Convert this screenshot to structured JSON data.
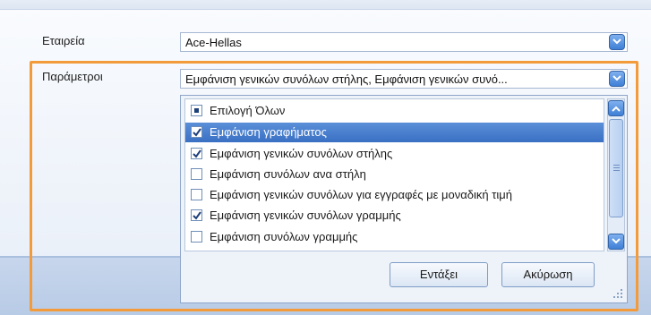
{
  "company": {
    "label": "Εταιρεία",
    "value": "Ace-Hellas"
  },
  "parameters": {
    "label": "Παράμετροι",
    "value": "Εμφάνιση γενικών συνόλων στήλης, Εμφάνιση γενικών συνό...",
    "items": [
      {
        "label": "Επιλογή Όλων",
        "state": "partial"
      },
      {
        "label": "Εμφάνιση γραφήματος",
        "state": "checked",
        "selected": true
      },
      {
        "label": "Εμφάνιση γενικών συνόλων στήλης",
        "state": "checked"
      },
      {
        "label": "Εμφάνιση συνόλων ανα στήλη",
        "state": "unchecked"
      },
      {
        "label": "Εμφάνιση γενικών συνόλων για εγγραφές με μοναδική τιμή",
        "state": "unchecked"
      },
      {
        "label": "Εμφάνιση γενικών συνόλων γραμμής",
        "state": "checked"
      },
      {
        "label": "Εμφάνιση συνόλων γραμμής",
        "state": "unchecked"
      }
    ],
    "ok_label": "Εντάξει",
    "cancel_label": "Ακύρωση"
  },
  "colors": {
    "highlight_border": "#f39b3a",
    "selection": "#3a70c4",
    "accent": "#3f7fd6"
  }
}
